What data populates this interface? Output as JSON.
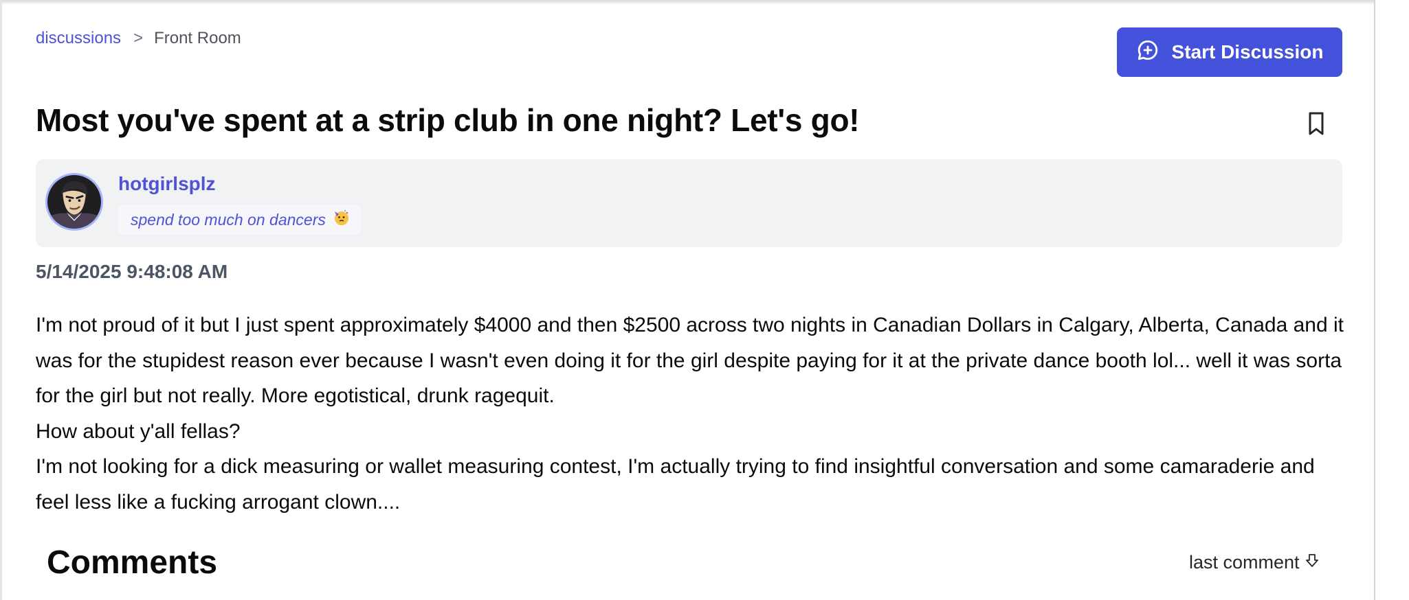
{
  "breadcrumb": {
    "root_label": "discussions",
    "separator": ">",
    "current_label": "Front Room"
  },
  "actions": {
    "start_discussion_label": "Start Discussion",
    "start_discussion_icon": "chat-plus-icon",
    "bookmark_icon": "bookmark-icon"
  },
  "post": {
    "title": "Most you've spent at a strip club in one night? Let's go!",
    "author": {
      "username": "hotgirlsplz",
      "flair": "spend too much on dancers",
      "flair_icon": "partying-face-emoji",
      "avatar_icon": "cartoon-man-avatar"
    },
    "timestamp": "5/14/2025 9:48:08 AM",
    "paragraphs": [
      "I'm not proud of it but I just spent approximately $4000 and then $2500 across two nights in Canadian Dollars in Calgary, Alberta, Canada and it was for the stupidest reason ever because I wasn't even doing it for the girl despite paying for it at the private dance booth lol... well it was sorta for the girl but not really. More egotistical, drunk ragequit.",
      "How about y'all fellas?",
      "I'm not looking for a dick measuring or wallet measuring contest, I'm actually trying to find insightful conversation and some camaraderie and feel less like a fucking arrogant clown...."
    ]
  },
  "comments": {
    "heading": "Comments",
    "sort_label": "last comment",
    "sort_icon": "arrow-down-icon"
  },
  "colors": {
    "accent": "#4451db",
    "link": "#4f52d6",
    "card_bg": "#f1f2f4",
    "muted_text": "#4b5563"
  }
}
